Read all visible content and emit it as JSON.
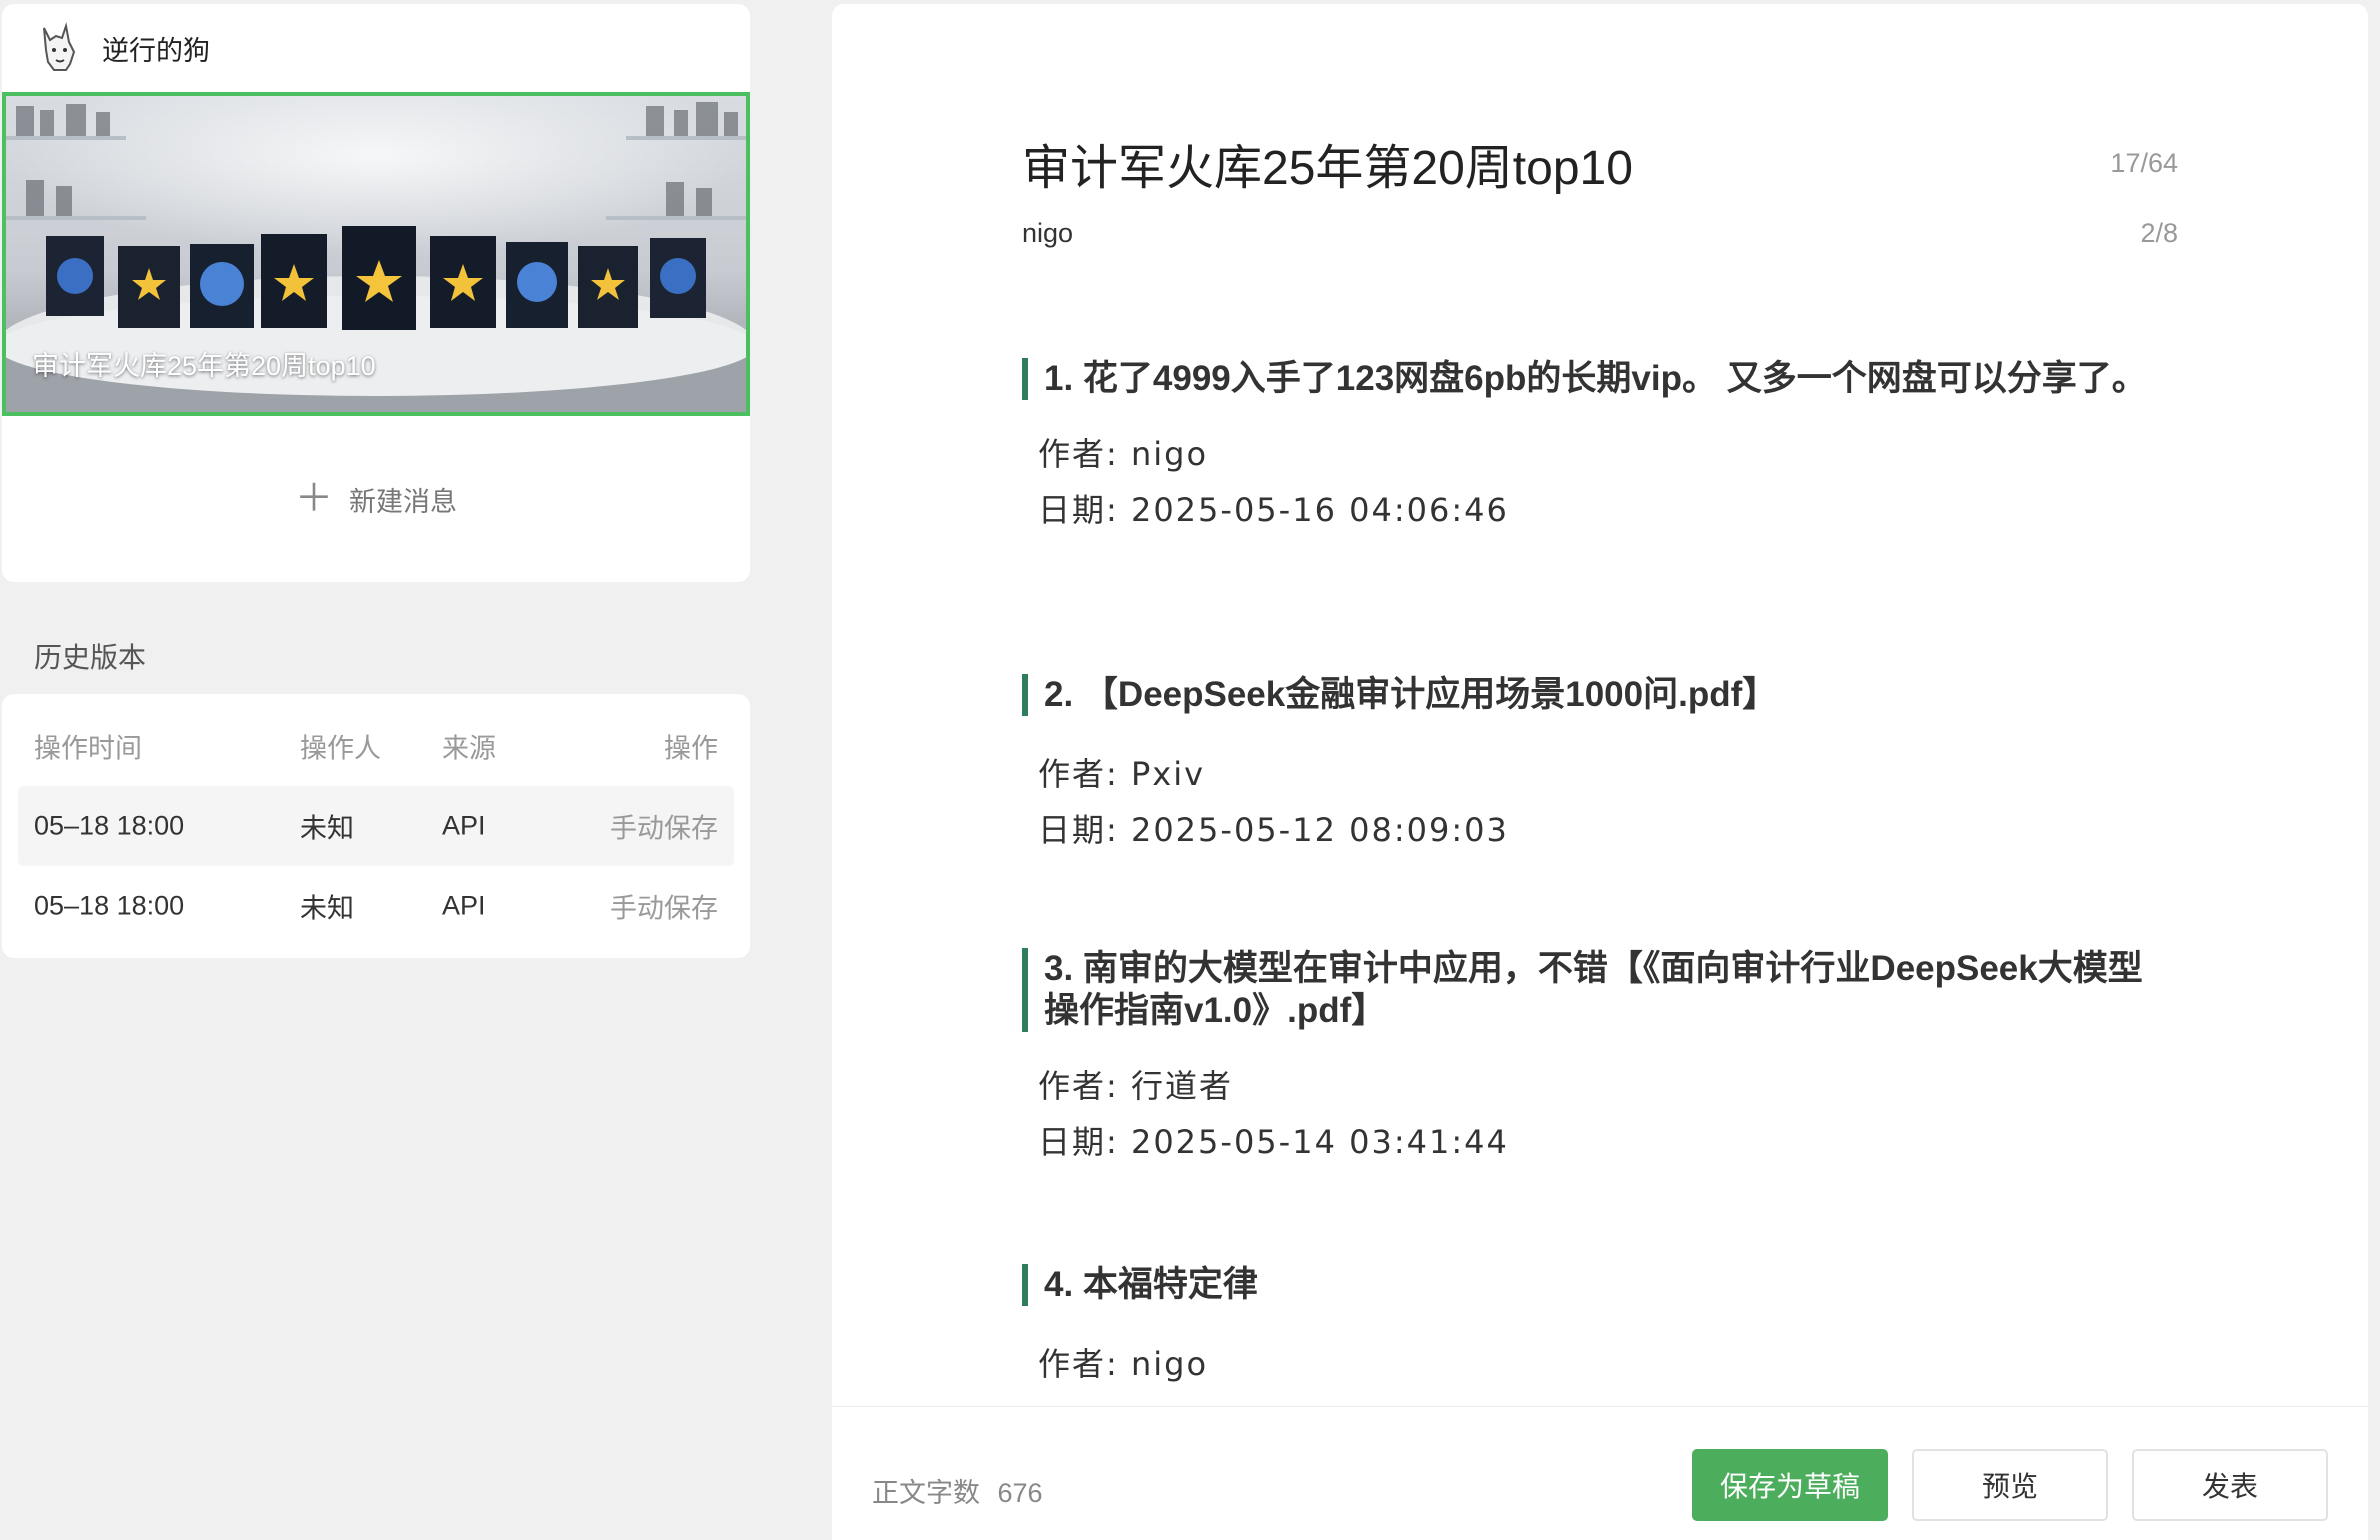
{
  "account": {
    "name": "逆行的狗",
    "avatar_icon": "dog-avatar-icon"
  },
  "cover": {
    "title": "审计军火库25年第20周top10",
    "image_icon": "cover-image-book-display"
  },
  "new_message": {
    "icon": "plus-icon",
    "label": "新建消息"
  },
  "history": {
    "label": "历史版本",
    "headers": [
      "操作时间",
      "操作人",
      "来源",
      "操作"
    ],
    "rows": [
      {
        "time": "05–18 18:00",
        "user": "未知",
        "source": "API",
        "action": "手动保存"
      },
      {
        "time": "05–18 18:00",
        "user": "未知",
        "source": "API",
        "action": "手动保存"
      }
    ]
  },
  "editor": {
    "title": "审计军火库25年第20周top10",
    "title_count": "17/64",
    "author": "nigo",
    "author_count": "2/8",
    "entries": [
      {
        "heading": "1. 花了4999入手了123网盘6pb的长期vip。 又多一个网盘可以分享了。",
        "author": "作者: nigo",
        "date": "日期: 2025-05-16 04:06:46"
      },
      {
        "heading": "2. 【DeepSeek金融审计应用场景1000问.pdf】",
        "author": "作者: Pxiv",
        "date": "日期: 2025-05-12 08:09:03"
      },
      {
        "heading": "3. 南审的大模型在审计中应用，不错【《面向审计行业DeepSeek大模型操作指南v1.0》.pdf】",
        "author": "作者: 行道者",
        "date": "日期: 2025-05-14 03:41:44"
      },
      {
        "heading": "4. 本福特定律",
        "author": "作者: nigo",
        "date": ""
      }
    ]
  },
  "footer": {
    "word_count_label": "正文字数",
    "word_count": "676",
    "save_label": "保存为草稿",
    "preview_label": "预览",
    "publish_label": "发表"
  },
  "colors": {
    "accent_green": "#4cae5d",
    "quote_bar": "#2e7d5b",
    "cover_border": "#4cbf60"
  }
}
